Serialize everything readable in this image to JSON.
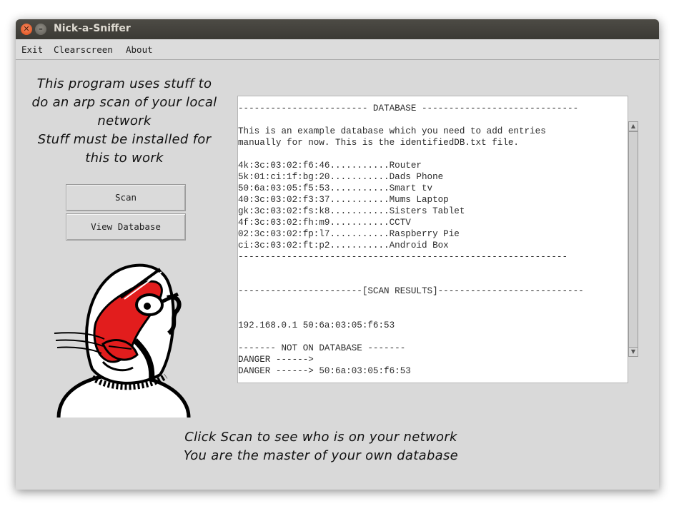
{
  "window": {
    "title": "Nick-a-Sniffer"
  },
  "menu": {
    "exit": "Exit",
    "clearscreen": "Clearscreen",
    "about": "About"
  },
  "intro": {
    "lines": [
      "This program uses stuff to",
      "do an arp scan of your local",
      "network",
      "Stuff must be installed for",
      "this to work"
    ]
  },
  "buttons": {
    "scan": "Scan",
    "view_database": "View Database"
  },
  "output": {
    "lines": [
      "------------------------ DATABASE -----------------------------",
      "",
      "This is an example database which you need to add entries",
      "manually for now. This is the identifiedDB.txt file.",
      "",
      "4k:3c:03:02:f6:46...........Router",
      "5k:01:ci:1f:bg:20...........Dads Phone",
      "50:6a:03:05:f5:53...........Smart tv",
      "40:3c:03:02:f3:37...........Mums Laptop",
      "gk:3c:03:02:fs:k8...........Sisters Tablet",
      "4f:3c:03:02:fh:m9...........CCTV",
      "02:3c:03:02:fp:l7...........Raspberry Pie",
      "ci:3c:03:02:ft:p2...........Android Box",
      "-------------------------------------------------------------",
      "",
      "",
      "-----------------------[SCAN RESULTS]---------------------------",
      "",
      "",
      "192.168.0.1 50:6a:03:05:f6:53",
      "",
      "------- NOT ON DATABASE -------",
      "DANGER ------>",
      "DANGER ------> 50:6a:03:05:f6:53"
    ]
  },
  "footer": {
    "line1": "Click Scan to see who is on your network",
    "line2": "You are the master of your own database"
  },
  "colors": {
    "mascot_red": "#e21d1d",
    "titlebar": "#3c3b37",
    "close_button": "#e9541f"
  }
}
